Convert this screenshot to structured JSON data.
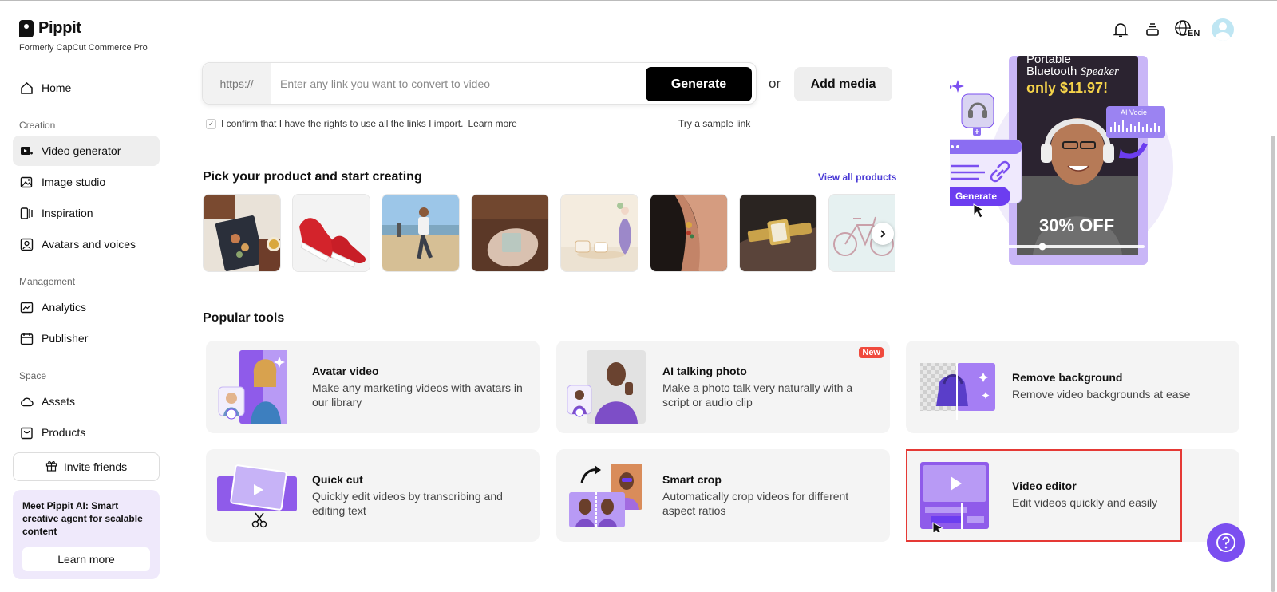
{
  "app": {
    "name": "Pippit",
    "subtitle": "Formerly CapCut Commerce Pro"
  },
  "sidebar": {
    "nav": [
      {
        "label": "Home",
        "icon": "home-icon"
      },
      {
        "label": "Video generator",
        "icon": "video-generator-icon",
        "active": true
      },
      {
        "label": "Image studio",
        "icon": "image-studio-icon"
      },
      {
        "label": "Inspiration",
        "icon": "inspiration-icon"
      },
      {
        "label": "Avatars and voices",
        "icon": "avatar-icon"
      },
      {
        "label": "Analytics",
        "icon": "analytics-icon"
      },
      {
        "label": "Publisher",
        "icon": "calendar-icon"
      },
      {
        "label": "Assets",
        "icon": "cloud-icon"
      },
      {
        "label": "Products",
        "icon": "bag-icon"
      }
    ],
    "sections": {
      "creation": "Creation",
      "management": "Management",
      "space": "Space"
    },
    "invite_label": "Invite friends",
    "promo": {
      "text": "Meet Pippit AI: Smart creative agent for scalable content",
      "button": "Learn more"
    }
  },
  "header": {
    "icons": [
      "bell-icon",
      "layers-icon",
      "language-icon"
    ],
    "language": "EN"
  },
  "url_bar": {
    "prefix": "https://",
    "placeholder": "Enter any link you want to convert to video",
    "value": "",
    "generate_label": "Generate",
    "or_text": "or",
    "add_media_label": "Add media",
    "confirm_text": "I confirm that I have the rights to use all the links I import.",
    "learn_more": "Learn more",
    "sample_link": "Try a sample link"
  },
  "products": {
    "title": "Pick your product and start creating",
    "view_all": "View all products",
    "items": [
      "notebook",
      "red sneakers",
      "beach photo",
      "soap bar",
      "candle and vase",
      "earring",
      "gold watch",
      "bicycle"
    ]
  },
  "hero": {
    "line1": "Portable",
    "line2": "Bluetooth",
    "line2_italic": "Speaker",
    "price": "only $11.97!",
    "discount": "30% OFF",
    "badge": "AI Vocie",
    "button": "Generate"
  },
  "tools": {
    "title": "Popular tools",
    "items": [
      {
        "title": "Avatar video",
        "desc": "Make any marketing videos with avatars in our library"
      },
      {
        "title": "AI talking photo",
        "desc": "Make a photo talk very naturally with a script or audio clip",
        "badge": "New"
      },
      {
        "title": "Remove background",
        "desc": "Remove video backgrounds at ease"
      },
      {
        "title": "Quick cut",
        "desc": "Quickly edit videos by transcribing and editing text"
      },
      {
        "title": "Smart crop",
        "desc": "Automatically crop videos for different aspect ratios"
      },
      {
        "title": "Video editor",
        "desc": "Edit videos quickly and easily",
        "highlighted": true
      }
    ]
  },
  "colors": {
    "accent": "#7b4ff0",
    "link": "#4b3bd6",
    "highlight": "#e53935",
    "new_badge": "#f04a3d"
  }
}
